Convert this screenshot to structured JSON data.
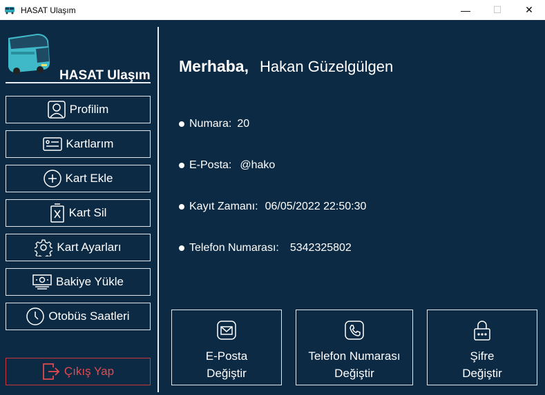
{
  "window": {
    "title": "HASAT Ulaşım",
    "minimize": "—",
    "maximize": "☐",
    "close": "✕"
  },
  "sidebar": {
    "brand": "HASAT Ulaşım",
    "items": [
      {
        "label": "Profilim",
        "icon": "user-icon"
      },
      {
        "label": "Kartlarım",
        "icon": "id-card-icon"
      },
      {
        "label": "Kart Ekle",
        "icon": "plus-circle-icon"
      },
      {
        "label": "Kart Sil",
        "icon": "delete-card-icon"
      },
      {
        "label": "Kart Ayarları",
        "icon": "gear-icon"
      },
      {
        "label": "Bakiye Yükle",
        "icon": "money-icon"
      },
      {
        "label": "Otobüs Saatleri",
        "icon": "clock-icon"
      }
    ],
    "exit": {
      "label": "Çıkış Yap",
      "icon": "logout-icon",
      "color": "#e24a4f"
    }
  },
  "main": {
    "greeting": "Merhaba,",
    "user_name": "Hakan Güzelgülgen",
    "info": [
      {
        "label": "Numara:",
        "value": "20"
      },
      {
        "label": "E-Posta:",
        "value": "@hako"
      },
      {
        "label": "Kayıt Zamanı:",
        "value": "06/05/2022 22:50:30"
      },
      {
        "label": "Telefon Numarası:",
        "value": "5342325802"
      }
    ],
    "actions": [
      {
        "line1": "E-Posta",
        "line2": "Değiştir",
        "icon": "envelope-icon"
      },
      {
        "line1": "Telefon Numarası",
        "line2": "Değiştir",
        "icon": "phone-icon"
      },
      {
        "line1": "Şifre",
        "line2": "Değiştir",
        "icon": "lock-icon"
      }
    ]
  },
  "colors": {
    "background": "#0d2a44",
    "text": "#ffffff",
    "exit": "#e24a4f"
  }
}
